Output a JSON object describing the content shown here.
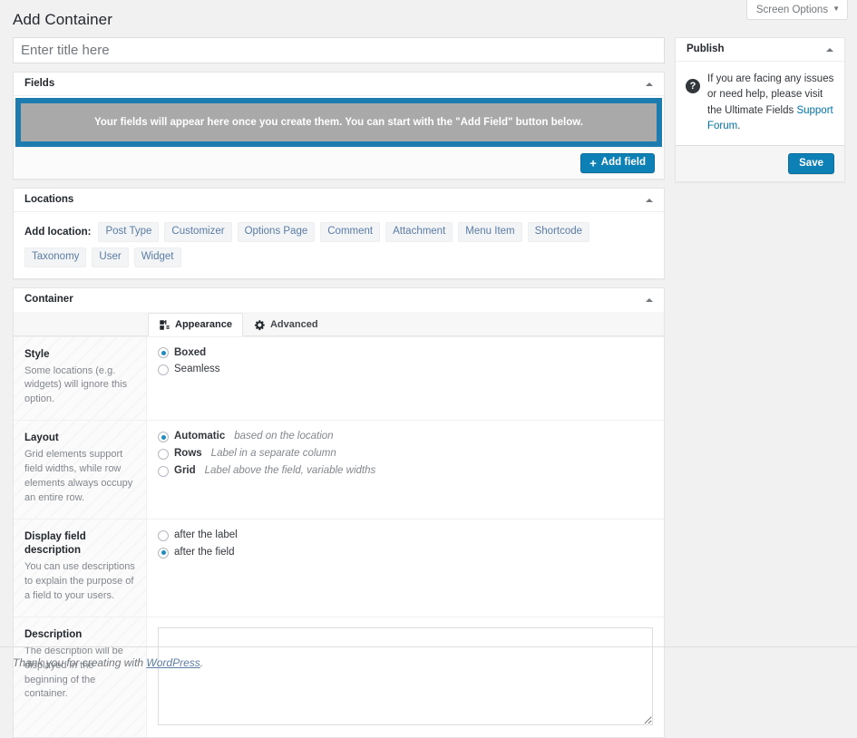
{
  "screen_meta": {
    "screen_options_label": "Screen Options",
    "caret_icon": "caret-down-icon"
  },
  "page": {
    "title": "Add Container"
  },
  "title_field": {
    "placeholder": "Enter title here",
    "value": ""
  },
  "fields_box": {
    "title": "Fields",
    "placeholder_text": "Your fields will appear here once you create them. You can start with the \"Add Field\" button below.",
    "add_field_label": "Add field",
    "add_field_icon": "plus-icon",
    "toggle_icon": "caret-up-icon",
    "accent_color": "#1c7cb0",
    "placeholder_bg": "#a9a9a9"
  },
  "locations_box": {
    "title": "Locations",
    "toggle_icon": "caret-up-icon",
    "add_location_label": "Add location:",
    "chips": [
      "Post Type",
      "Customizer",
      "Options Page",
      "Comment",
      "Attachment",
      "Menu Item",
      "Shortcode",
      "Taxonomy",
      "User",
      "Widget"
    ]
  },
  "container_box": {
    "title": "Container",
    "toggle_icon": "caret-up-icon",
    "tabs": [
      {
        "label": "Appearance",
        "icon": "appearance-icon",
        "active": true
      },
      {
        "label": "Advanced",
        "icon": "gear-icon",
        "active": false
      }
    ],
    "rows": [
      {
        "label": "Style",
        "description": "Some locations (e.g. widgets) will ignore this option.",
        "type": "radio",
        "options": [
          {
            "label": "Boxed",
            "hint": "",
            "checked": true
          },
          {
            "label": "Seamless",
            "hint": "",
            "checked": false
          }
        ]
      },
      {
        "label": "Layout",
        "description": "Grid elements support field widths, while row elements always occupy an entire row.",
        "type": "radio",
        "options": [
          {
            "label": "Automatic",
            "hint": "based on the location",
            "checked": true
          },
          {
            "label": "Rows",
            "hint": "Label in a separate column",
            "checked": false
          },
          {
            "label": "Grid",
            "hint": "Label above the field, variable widths",
            "checked": false
          }
        ]
      },
      {
        "label": "Display field description",
        "description": "You can use descriptions to explain the purpose of a field to your users.",
        "type": "radio",
        "options": [
          {
            "label": "after the label",
            "hint": "",
            "checked": false
          },
          {
            "label": "after the field",
            "hint": "",
            "checked": true
          }
        ]
      },
      {
        "label": "Description",
        "description": "The description will be displayed in the beginning of the container.",
        "type": "textarea",
        "value": "",
        "placeholder": ""
      }
    ]
  },
  "sidebar": {
    "publish": {
      "title": "Publish",
      "toggle_icon": "caret-up-icon",
      "help_icon": "question-mark-icon",
      "help_text_before": "If you are facing any issues or need help, please visit the Ultimate Fields ",
      "help_link": "Support Forum",
      "help_text_after": ".",
      "save_label": "Save"
    }
  },
  "footer": {
    "text_before": "Thank you for creating with ",
    "link": "WordPress",
    "text_after": "."
  }
}
